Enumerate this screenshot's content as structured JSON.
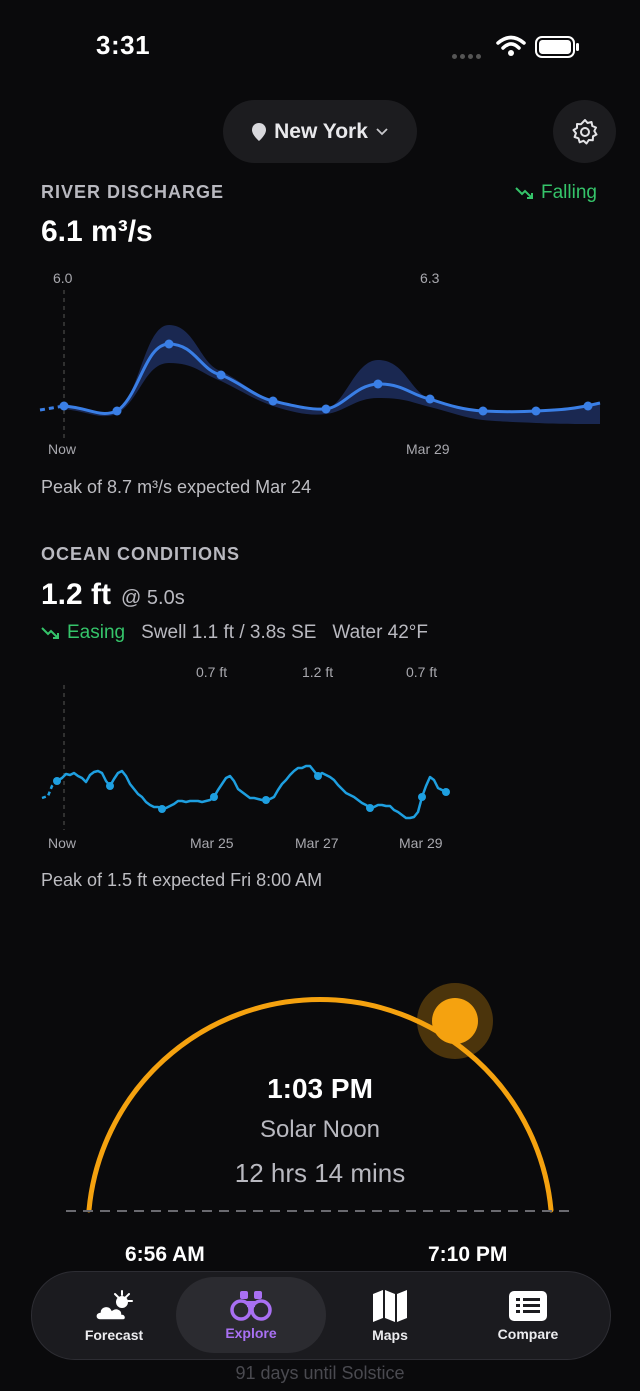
{
  "status_bar": {
    "time": "3:31"
  },
  "header": {
    "location": "New York"
  },
  "river": {
    "title": "RIVER DISCHARGE",
    "trend": "Falling",
    "value": "6.1 m³/s",
    "peak_labels": [
      "6.0",
      "6.3"
    ],
    "x_labels": [
      "Now",
      "Mar 29"
    ],
    "note": "Peak of 8.7 m³/s expected Mar 24"
  },
  "ocean": {
    "title": "OCEAN CONDITIONS",
    "value": "1.2 ft",
    "period": "@ 5.0s",
    "trend": "Easing",
    "swell": "Swell 1.1 ft / 3.8s SE",
    "water": "Water 42°F",
    "peak_labels": [
      "0.7 ft",
      "1.2 ft",
      "0.7 ft"
    ],
    "x_labels": [
      "Now",
      "Mar 25",
      "Mar 27",
      "Mar 29"
    ],
    "note": "Peak of 1.5 ft expected Fri 8:00 AM"
  },
  "solar": {
    "time": "1:03 PM",
    "label": "Solar Noon",
    "daylight": "12 hrs 14 mins",
    "sunrise": "6:56 AM",
    "sunset": "7:10 PM",
    "solstice": "91 days until Solstice",
    "arc_color": "#f5a20f"
  },
  "tabs": [
    {
      "label": "Forecast",
      "icon": "cloud-sun-icon"
    },
    {
      "label": "Explore",
      "icon": "binoculars-icon",
      "active": true
    },
    {
      "label": "Maps",
      "icon": "map-icon"
    },
    {
      "label": "Compare",
      "icon": "list-icon"
    }
  ],
  "colors": {
    "accent_green": "#35c46a",
    "river_line": "#3a7fe6",
    "ocean_line": "#1e9fe0",
    "active_tab": "#a970f3"
  }
}
